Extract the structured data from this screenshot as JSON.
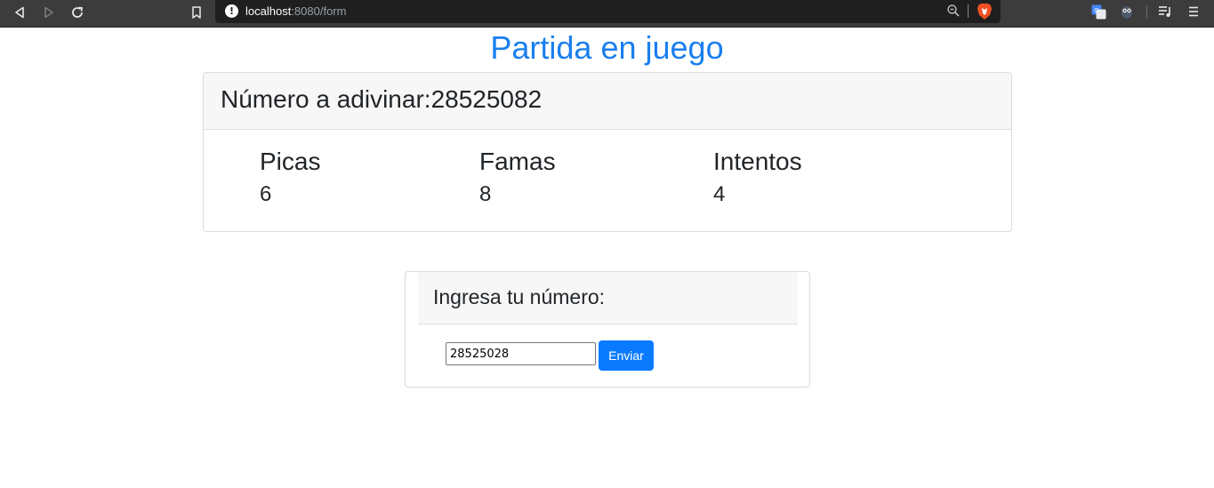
{
  "browser": {
    "url_host": "localhost",
    "url_path": ":8080/form",
    "icons": {
      "back": "back-arrow-icon",
      "forward": "forward-arrow-icon",
      "reload": "reload-icon",
      "bookmark": "bookmark-icon",
      "site_info": "info-icon",
      "zoom": "zoom-icon",
      "shields": "brave-shield-icon",
      "translate_extension": "translate-icon",
      "owl_extension": "owl-icon",
      "playlist": "playlist-icon",
      "menu": "hamburger-menu-icon"
    }
  },
  "page": {
    "title": "Partida en juego",
    "title_color": "#1a7fef"
  },
  "game": {
    "header_label": "Número a adivinar:",
    "target_number": "28525082",
    "stats": [
      {
        "label": "Picas",
        "value": "6"
      },
      {
        "label": "Famas",
        "value": "8"
      },
      {
        "label": "Intentos",
        "value": "4"
      }
    ]
  },
  "form": {
    "header": "Ingresa tu número:",
    "input_value": "28525028",
    "submit_label": "Enviar",
    "submit_color": "#0a7bff"
  }
}
